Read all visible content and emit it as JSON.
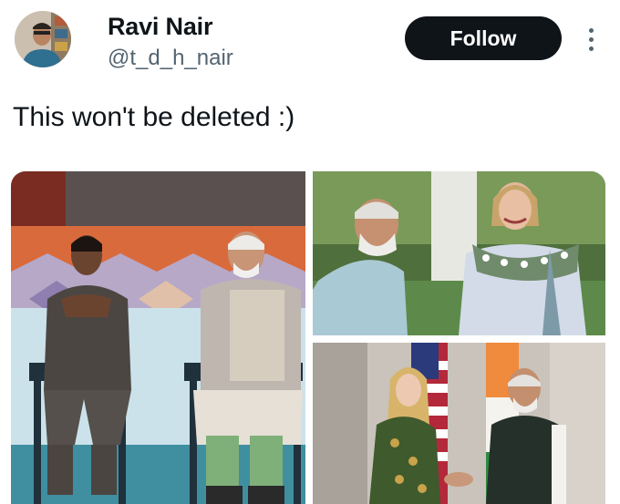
{
  "author": {
    "display_name": "Ravi Nair",
    "handle": "@t_d_h_nair",
    "avatar_icon": "user-avatar"
  },
  "actions": {
    "follow_label": "Follow",
    "more_icon": "more-vertical-icon"
  },
  "tweet": {
    "text": "This won't be deleted :)"
  },
  "media": {
    "count": 3
  },
  "colors": {
    "follow_bg": "#0f1419",
    "handle": "#536471"
  }
}
